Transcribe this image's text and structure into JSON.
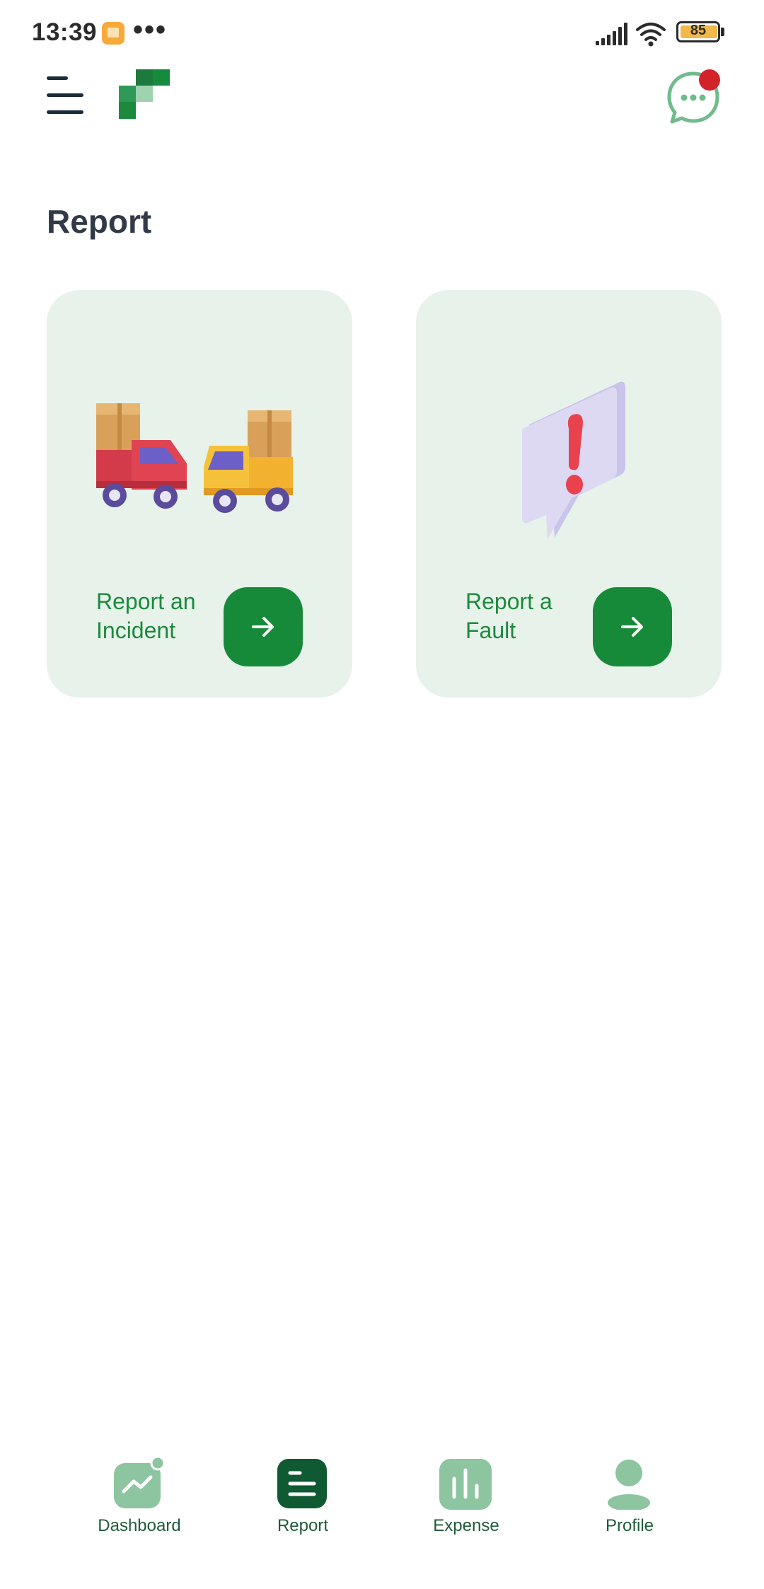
{
  "status_bar": {
    "time": "13:39",
    "dots": "•••",
    "battery": "85"
  },
  "header": {
    "menu_icon": "menu-icon",
    "logo": "app-logo",
    "chat_icon": "chat-icon"
  },
  "page": {
    "title": "Report"
  },
  "cards": [
    {
      "label": "Report an Incident",
      "illustration": "delivery-trucks-illustration",
      "action_icon": "arrow-right-icon"
    },
    {
      "label": "Report a Fault",
      "illustration": "alert-bubble-illustration",
      "action_icon": "arrow-right-icon"
    }
  ],
  "bottom_nav": {
    "items": [
      {
        "label": "Dashboard",
        "icon": "dashboard-icon",
        "active": false
      },
      {
        "label": "Report",
        "icon": "report-icon",
        "active": true
      },
      {
        "label": "Expense",
        "icon": "expense-icon",
        "active": false
      },
      {
        "label": "Profile",
        "icon": "profile-icon",
        "active": false
      }
    ]
  },
  "colors": {
    "primary": "#178a3a",
    "card_bg": "#e7f2ea",
    "nav_active": "#0f5a32",
    "nav_inactive": "#8cc5a0",
    "badge": "#d2232a",
    "title": "#333a47"
  }
}
